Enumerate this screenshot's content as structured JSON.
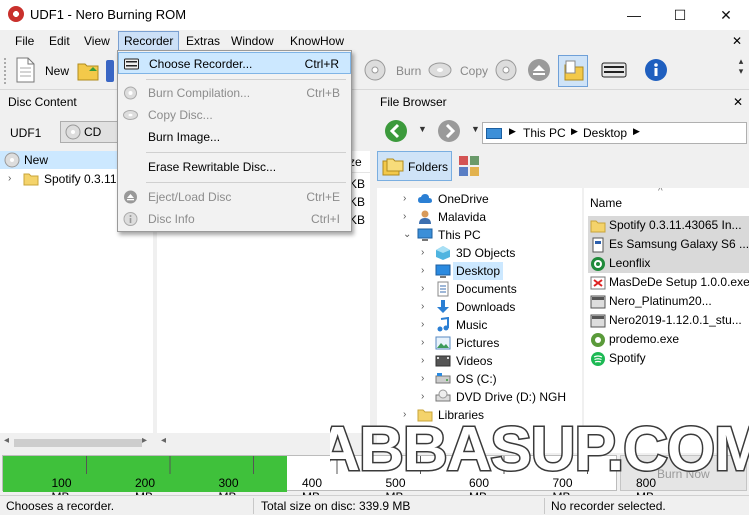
{
  "window": {
    "title": "UDF1 - Nero Burning ROM",
    "min": "—",
    "max": "☐",
    "close": "✕"
  },
  "menu": {
    "items": [
      "File",
      "Edit",
      "View",
      "Recorder",
      "Extras",
      "Window",
      "KnowHow"
    ],
    "close_symbol": "✕"
  },
  "toolbar": {
    "new": "New",
    "burn": "Burn",
    "copy": "Copy"
  },
  "recorder_menu": [
    {
      "label": "Choose Recorder...",
      "shortcut": "Ctrl+R",
      "enabled": true,
      "icon": "recorder-icon"
    },
    {
      "label": "Burn Compilation...",
      "shortcut": "Ctrl+B",
      "enabled": false,
      "icon": "burn-icon"
    },
    {
      "label": "Copy Disc...",
      "shortcut": "",
      "enabled": false,
      "icon": "copy-disc-icon"
    },
    {
      "label": "Burn Image...",
      "shortcut": "",
      "enabled": true,
      "icon": ""
    },
    {
      "label": "Erase Rewritable Disc...",
      "shortcut": "",
      "enabled": true,
      "icon": ""
    },
    {
      "label": "Eject/Load Disc",
      "shortcut": "Ctrl+E",
      "enabled": false,
      "icon": "eject-icon"
    },
    {
      "label": "Disc Info",
      "shortcut": "Ctrl+I",
      "enabled": false,
      "icon": "info-icon"
    }
  ],
  "disc_content": {
    "title": "Disc Content",
    "disc_label": "UDF1",
    "disc_type": "CD",
    "tree": [
      {
        "label": "New"
      },
      {
        "label": "Spotify 0.3.11."
      }
    ],
    "col_size_partial": "ze",
    "size_partials": [
      "KB",
      "KB",
      "KB"
    ]
  },
  "file_browser": {
    "title": "File Browser",
    "breadcrumb": [
      "This PC",
      "Desktop"
    ],
    "folders_button": "Folders",
    "tree": [
      {
        "label": "OneDrive",
        "indent": 0,
        "expanded": false,
        "icon": "cloud-icon"
      },
      {
        "label": "Malavida",
        "indent": 0,
        "expanded": false,
        "icon": "user-icon"
      },
      {
        "label": "This PC",
        "indent": 0,
        "expanded": true,
        "icon": "computer-icon"
      },
      {
        "label": "3D Objects",
        "indent": 1,
        "expanded": false,
        "icon": "cube-icon"
      },
      {
        "label": "Desktop",
        "indent": 1,
        "expanded": false,
        "icon": "desktop-icon",
        "selected": true
      },
      {
        "label": "Documents",
        "indent": 1,
        "expanded": false,
        "icon": "documents-icon"
      },
      {
        "label": "Downloads",
        "indent": 1,
        "expanded": false,
        "icon": "downloads-icon"
      },
      {
        "label": "Music",
        "indent": 1,
        "expanded": false,
        "icon": "music-icon"
      },
      {
        "label": "Pictures",
        "indent": 1,
        "expanded": false,
        "icon": "pictures-icon"
      },
      {
        "label": "Videos",
        "indent": 1,
        "expanded": false,
        "icon": "videos-icon"
      },
      {
        "label": "OS (C:)",
        "indent": 1,
        "expanded": false,
        "icon": "drive-icon"
      },
      {
        "label": "DVD Drive (D:) NGH",
        "indent": 1,
        "expanded": false,
        "icon": "dvd-icon"
      },
      {
        "label": "Libraries",
        "indent": 0,
        "expanded": false,
        "icon": "folder-icon"
      }
    ],
    "name_header": "Name",
    "files": [
      {
        "label": "Spotify 0.3.11.43065 In...",
        "icon": "folder-icon",
        "selected": true
      },
      {
        "label": "Es Samsung Galaxy S6 ...",
        "icon": "document-icon",
        "selected": true
      },
      {
        "label": "Leonflix",
        "icon": "leonflix-icon",
        "selected": true
      },
      {
        "label": "MasDeDe Setup 1.0.0.exe",
        "icon": "exe-icon",
        "selected": false
      },
      {
        "label": "Nero_Platinum20...",
        "icon": "nero-setup-icon",
        "selected": false
      },
      {
        "label": "Nero2019-1.12.0.1_stu...",
        "icon": "nero-setup-icon",
        "selected": false
      },
      {
        "label": "prodemo.exe",
        "icon": "prodemo-icon",
        "selected": false
      },
      {
        "label": "Spotify",
        "icon": "spotify-icon",
        "selected": false
      }
    ]
  },
  "capacity": {
    "used_mb": 339.9,
    "max_mb": 850,
    "ticks": [
      "100 MB",
      "200 MB",
      "300 MB",
      "400 MB",
      "500 MB",
      "600 MB",
      "700 MB",
      "800 MB"
    ],
    "burn_now": "Burn Now",
    "fill_color": "#3fc13b"
  },
  "status": {
    "left": "Chooses a recorder.",
    "middle": "Total size on disc: 339.9 MB",
    "right": "No recorder selected."
  },
  "watermark": "ABBASUP.COM"
}
